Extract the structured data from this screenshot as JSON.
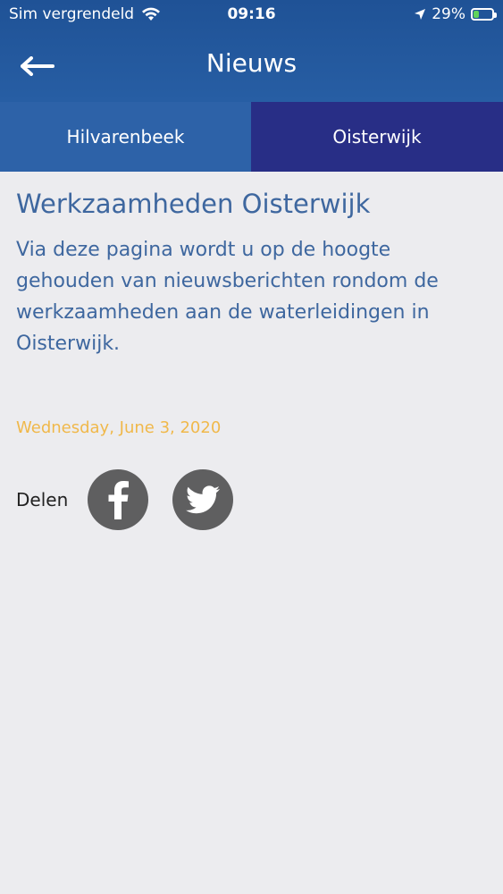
{
  "status_bar": {
    "carrier": "Sim vergrendeld",
    "time": "09:16",
    "battery_percent": "29%",
    "battery_level": 0.29
  },
  "nav": {
    "title": "Nieuws",
    "back_icon": "arrow-left-icon"
  },
  "tabs": [
    {
      "label": "Hilvarenbeek",
      "active": false
    },
    {
      "label": "Oisterwijk",
      "active": true
    }
  ],
  "article": {
    "title": "Werkzaamheden Oisterwijk",
    "body": "Via deze pagina wordt u op de hoogte gehouden van nieuwsberichten rondom de werkzaamheden aan de waterleidingen in Oisterwijk.",
    "date": "Wednesday, June 3, 2020"
  },
  "share": {
    "label": "Delen",
    "buttons": [
      "facebook-icon",
      "twitter-icon"
    ]
  },
  "colors": {
    "header": "#275ea4",
    "tab_active": "#282e86",
    "tab_inactive": "#2d62a8",
    "text_blue": "#3e679f",
    "date": "#f0b84a",
    "social_button": "#5f5f60",
    "background": "#ececef"
  }
}
